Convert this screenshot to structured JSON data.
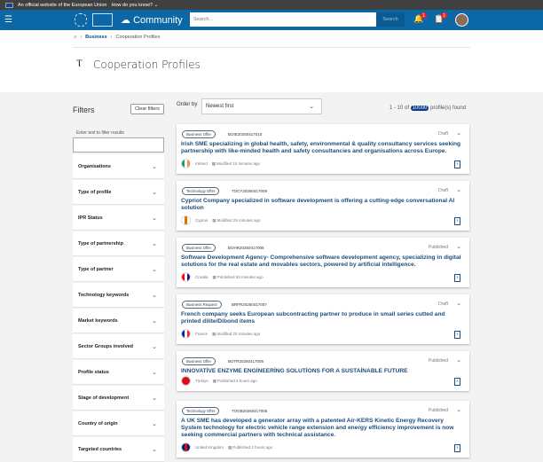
{
  "eubar": {
    "text": "An official website of the European Union",
    "how": "How do you know?"
  },
  "nav": {
    "brand": "Community",
    "search_placeholder": "Search...",
    "search_button": "Search",
    "notif_count": "1",
    "tasks_count": "1"
  },
  "breadcrumb": [
    "Business",
    "Cooperation Profiles"
  ],
  "page_title": "Cooperation Profiles",
  "filters": {
    "title": "Filters",
    "clear": "Clear filters",
    "text_label": "Enter text to filter results",
    "items": [
      "Organisations",
      "Type of profile",
      "IPR Status",
      "Type of partnership",
      "Type of partner",
      "Technology keywords",
      "Market keywords",
      "Sector Groups involved",
      "Profile status",
      "Stage of development",
      "Country of origin",
      "Targeted countries"
    ]
  },
  "order": {
    "label": "Order by",
    "value": "Newest first"
  },
  "results": {
    "prefix": "1 - 10 of",
    "total": "10000",
    "suffix": "profile(s) found"
  },
  "cards": [
    {
      "type": "Business Offer",
      "id": "BOIE20250417010",
      "status": "Draft",
      "title": "Irish SME specializing in global health, safety, environmental & quality consultancy services seeking partnership with like-minded health and safety consultancies and organisations across Europe.",
      "country": "Ireland",
      "time": "Modified 15 minutes ago",
      "flag": [
        "#169b62",
        "#ffffff",
        "#ff883e"
      ]
    },
    {
      "type": "Technology Offer",
      "id": "TOCY20250417009",
      "status": "Draft",
      "title": "Cypriot Company specialized in software development is offering a cutting-edge conversational AI solution",
      "country": "Cyprus",
      "time": "Modified 25 minutes ago",
      "flag": [
        "#ffffff",
        "#d57800",
        "#ffffff"
      ]
    },
    {
      "type": "Business Offer",
      "id": "BOHR20250417008",
      "status": "Published",
      "title": "Software Development Agency- Comprehensive software development agency, specializing in digital solutions for the real estate and movables sectors, powered by artificial intelligence.",
      "country": "Croatia",
      "time": "Published 53 minutes ago",
      "flag": [
        "#ff0000",
        "#ffffff",
        "#171796"
      ]
    },
    {
      "type": "Business Request",
      "id": "BRFR20250417007",
      "status": "Draft",
      "title": "French company seeks European subcontracting partner to produce in small series cutted and printed dilite/Dibond items",
      "country": "France",
      "time": "Modified 23 minutes ago",
      "flag": [
        "#002395",
        "#ffffff",
        "#ed2939"
      ]
    },
    {
      "type": "Business Offer",
      "id": "BOTR20250417006",
      "status": "Published",
      "title": "INNOVATİVE ENZYME ENGİNEERİNG SOLUTİONS FOR A SUSTAİNABLE FUTURE",
      "country": "Türkiye",
      "time": "Published 2 hours ago",
      "flag": [
        "#e30a17",
        "#e30a17",
        "#e30a17"
      ]
    },
    {
      "type": "Technology Offer",
      "id": "TOGB20250417005",
      "status": "Published",
      "title": "A UK SME has developed a generator array with a patented Air-KERS Kinetic Energy Recovery System technology for electric vehicle range extension and energy efficiency improvement is now seeking commercial partners with technical assistance.",
      "country": "United Kingdom",
      "time": "Published 2 hours ago",
      "flag": [
        "#012169",
        "#c8102e",
        "#012169"
      ]
    }
  ]
}
